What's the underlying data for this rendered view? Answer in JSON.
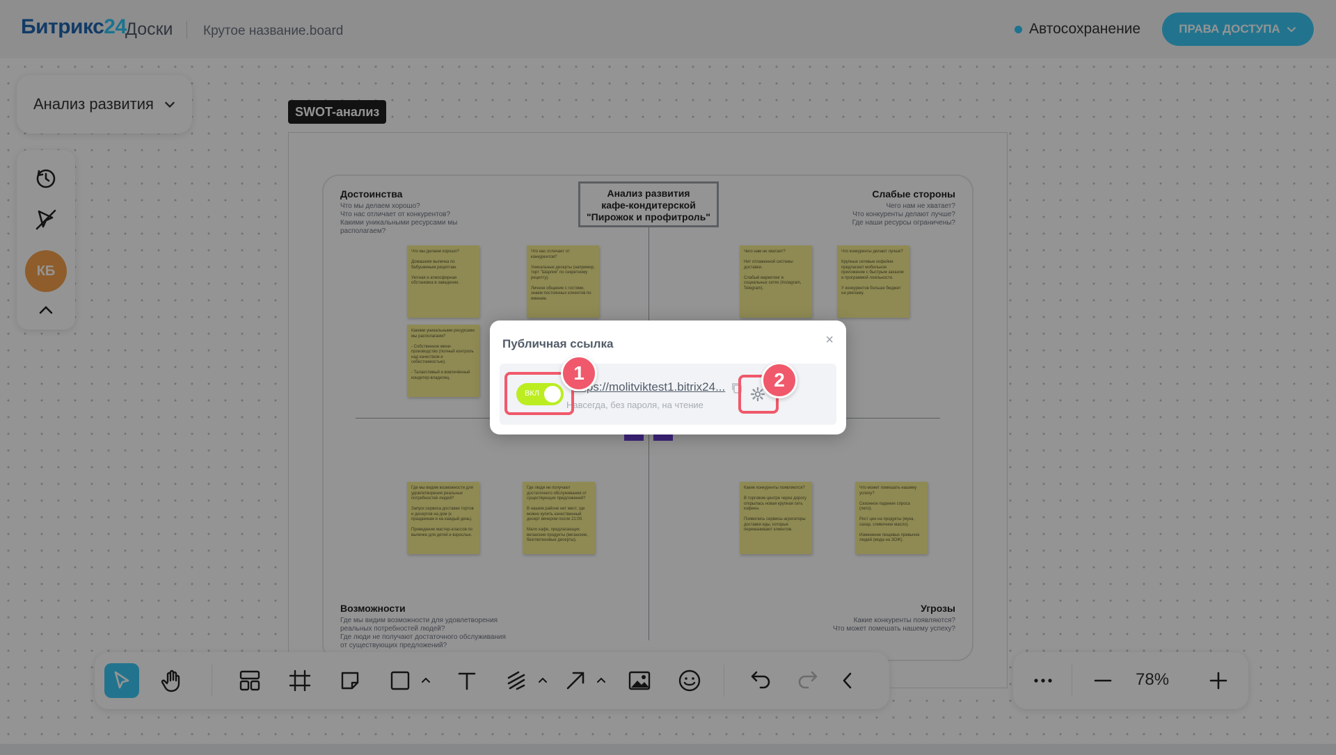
{
  "header": {
    "logo_brand": "Битрикс",
    "logo_num": "24",
    "logo_sub": "Доски",
    "board_name": "Крутое название.board",
    "autosave": "Автосохранение",
    "access_button": "ПРАВА ДОСТУПА"
  },
  "left": {
    "frame_dropdown": "Анализ развития",
    "avatar_initials": "КБ"
  },
  "board": {
    "frame_label": "SWOT-анализ",
    "center_title": [
      "Анализ развития",
      "кафе-кондитерской",
      "\"Пирожок и профитроль\""
    ],
    "quadrants": [
      {
        "title": "Достоинства",
        "desc": "Что мы делаем хорошо?\nЧто нас отличает от конкурентов?\nКакими уникальными ресурсами мы располагаем?"
      },
      {
        "title": "Слабые стороны",
        "desc": "Чего нам не хватает?\nЧто конкуренты делают лучше?\nГде наши ресурсы ограничены?"
      },
      {
        "title": "Возможности",
        "desc": "Где мы видим возможности для удовлетворения реальных потребностей людей?\nГде люди не получают достаточного обслуживания от существующих предложений?"
      },
      {
        "title": "Угрозы",
        "desc": "Какие конкуренты появляются?\nЧто может помешать нашему успеху?"
      }
    ],
    "stickies": [
      "Что мы делаем хорошо?\n\nДомашняя выпечка по бабушкиным рецептам.\n\nУютная и атмосферная обстановка в заведении.",
      "Что нас отличает от конкурентов?\n\nУникальные десерты (например, торт \"Шарлик\" по секретному рецепту).\n\nЛичное общение с гостями, знаем постоянных клиентов по именам.",
      "Какими уникальными ресурсами мы располагаем?\n\n- Собственное мини-производство (полный контроль над качеством и себестоимостью).\n\n- Талантливый и вовлечённый кондитер-владелец.",
      "Чего нам не хватает?\n\nНет отлаженной системы доставки.\n\nСлабый маркетинг в социальных сетях (Instagram, Telegram).",
      "Что конкуренты делают лучше?\n\nКрупные сетевые кофейни предлагают мобильное приложение с быстрым заказом и программой лояльности.\n\nУ конкурентов больше бюджет на рекламу.",
      "Где мы видим возможности для удовлетворения реальных потребностей людей?\n\nЗапуск сервиса доставки тортов и десертов на дом (к праздникам и на каждый день).\n\nПроведение мастер-классов по выпечке для детей и взрослых.",
      "Где люди не получают достаточного обслуживания от существующих предложений?\n\nВ нашем районе нет мест, где можно купить качественный десерт вечером после 21:00.\n\nМало кафе, предлагающих веганские продукты (веганские, безглютеновые десерты).",
      "Какие конкуренты появляются?\n\nВ торговом центре через дорогу открылась новая крупная сеть кофеен.\n\nПоявились сервисы-агрегаторы доставки еды, которые переманивают клиентов.",
      "Что может помешать нашему успеху?\n\nСезонное падение спроса (лето).\n\nРост цен на продукты (мука, сахар, сливочное масло).\n\nИзменение пищевых привычек людей (мода на ЗОЖ)."
    ]
  },
  "modal": {
    "title": "Публичная ссылка",
    "toggle_label": "ВКЛ",
    "link": "https://molitviktest1.bitrix24...",
    "hint": "Навсегда, без пароля, на чтение",
    "marker_1": "1",
    "marker_2": "2",
    "toggle_on": true
  },
  "zoom": {
    "value": "78%"
  },
  "colors": {
    "brand_blue": "#2067b0",
    "accent": "#3bc8f5",
    "toggle_on": "#bbed21",
    "marker": "#f0596b",
    "sticky": "#f6ee8f"
  }
}
